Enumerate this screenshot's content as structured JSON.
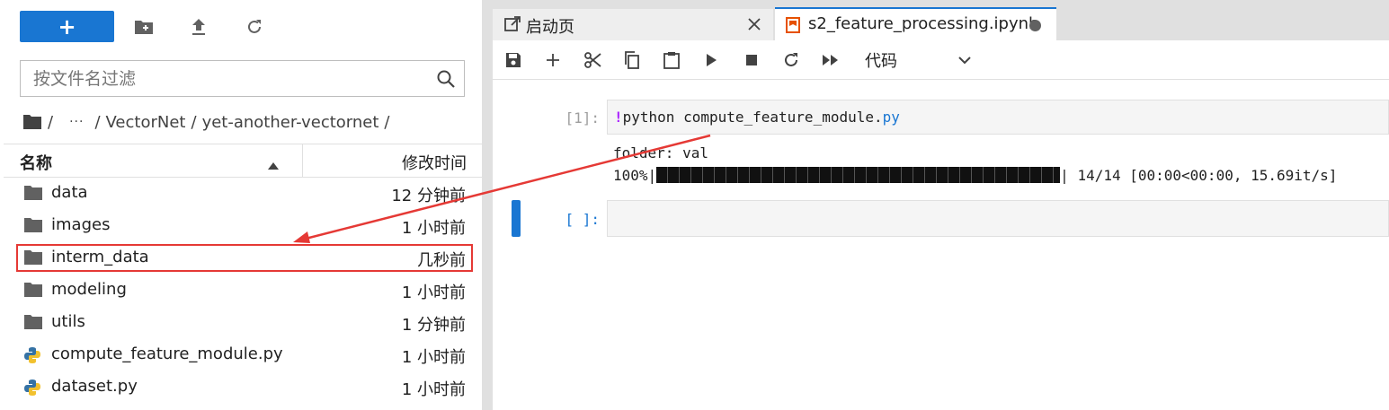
{
  "filebrowser": {
    "new_label": "+",
    "search_placeholder": "按文件名过滤",
    "breadcrumb": {
      "sep1": "/",
      "ellipsis": "···",
      "sep2": "/",
      "folder1": "VectorNet",
      "sep3": "/",
      "folder2": "yet-another-vectornet",
      "sep4": "/"
    },
    "columns": {
      "name": "名称",
      "modified": "修改时间"
    },
    "items": [
      {
        "name": "data",
        "modified": "12 分钟前",
        "kind": "folder"
      },
      {
        "name": "images",
        "modified": "1 小时前",
        "kind": "folder"
      },
      {
        "name": "interm_data",
        "modified": "几秒前",
        "kind": "folder"
      },
      {
        "name": "modeling",
        "modified": "1 小时前",
        "kind": "folder"
      },
      {
        "name": "utils",
        "modified": "1 分钟前",
        "kind": "folder"
      },
      {
        "name": "compute_feature_module.py",
        "modified": "1 小时前",
        "kind": "python"
      },
      {
        "name": "dataset.py",
        "modified": "1 小时前",
        "kind": "python"
      }
    ]
  },
  "tabs": [
    {
      "label": "启动页",
      "icon": "launcher-icon"
    },
    {
      "label": "s2_feature_processing.ipynb",
      "icon": "notebook-icon"
    }
  ],
  "notebook": {
    "cell_type": "代码",
    "cells": [
      {
        "prompt": "[1]:",
        "code_bang": "!",
        "code_text": "python compute_feature_module.",
        "code_ext": "py",
        "output_line1": "folder: val",
        "output_prefix": "100%|",
        "output_suffix": "| 14/14 [00:00<00:00, 15.69it/s]"
      },
      {
        "prompt": "[ ]:"
      }
    ]
  },
  "colors": {
    "accent": "#1976d2",
    "highlight": "#e53935",
    "python_blue": "#3572a5",
    "python_yellow": "#f2c12e",
    "notebook_orange": "#e65100"
  }
}
